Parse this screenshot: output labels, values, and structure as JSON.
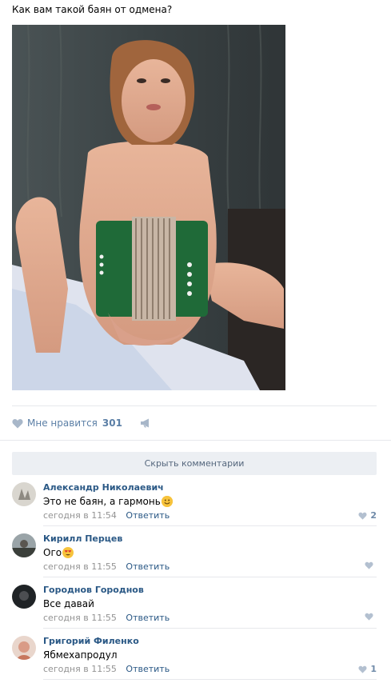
{
  "post": {
    "text": "Как вам такой баян от одмена?",
    "photo_alt": "photo"
  },
  "actions": {
    "like_label": "Мне нравится",
    "like_count": "301",
    "like_icon": "heart-icon",
    "share_icon": "megaphone-icon"
  },
  "comments_toggle": "Скрыть комментарии",
  "colors": {
    "link": "#2a5885",
    "meta": "#939393",
    "accent": "#5b7fa6",
    "button_bg": "#eceff3"
  },
  "comments": [
    {
      "author": "Александр Николаевич",
      "text": "Это не баян, а гармонь",
      "emoji": "smile-emoji",
      "time": "сегодня в 11:54",
      "reply": "Ответить",
      "likes": "2"
    },
    {
      "author": "Кирилл Перцев",
      "text": "Ого",
      "emoji": "heart-eyes-emoji",
      "time": "сегодня в 11:55",
      "reply": "Ответить",
      "likes": ""
    },
    {
      "author": "Городнов Городнов",
      "text": "Все давай",
      "time": "сегодня в 11:55",
      "reply": "Ответить",
      "likes": ""
    },
    {
      "author": "Григорий Филенко",
      "text": "Ябмехапродул",
      "time": "сегодня в 11:55",
      "reply": "Ответить",
      "likes": "1"
    }
  ]
}
